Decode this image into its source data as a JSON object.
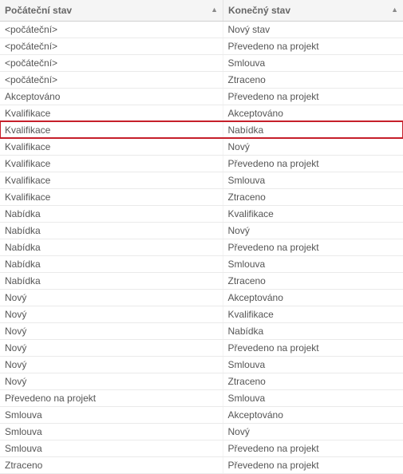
{
  "header": {
    "initial_state_label": "Počáteční stav",
    "final_state_label": "Konečný stav",
    "sort_icon": "▲"
  },
  "rows": [
    {
      "initial": "<počáteční>",
      "final": "Nový stav"
    },
    {
      "initial": "<počáteční>",
      "final": "Převedeno na projekt"
    },
    {
      "initial": "<počáteční>",
      "final": "Smlouva"
    },
    {
      "initial": "<počáteční>",
      "final": "Ztraceno"
    },
    {
      "initial": "Akceptováno",
      "final": "Převedeno na projekt"
    },
    {
      "initial": "Kvalifikace",
      "final": "Akceptováno"
    },
    {
      "initial": "Kvalifikace",
      "final": "Nabídka",
      "highlight": true
    },
    {
      "initial": "Kvalifikace",
      "final": "Nový"
    },
    {
      "initial": "Kvalifikace",
      "final": "Převedeno na projekt"
    },
    {
      "initial": "Kvalifikace",
      "final": "Smlouva"
    },
    {
      "initial": "Kvalifikace",
      "final": "Ztraceno"
    },
    {
      "initial": "Nabídka",
      "final": "Kvalifikace"
    },
    {
      "initial": "Nabídka",
      "final": "Nový"
    },
    {
      "initial": "Nabídka",
      "final": "Převedeno na projekt"
    },
    {
      "initial": "Nabídka",
      "final": "Smlouva"
    },
    {
      "initial": "Nabídka",
      "final": "Ztraceno"
    },
    {
      "initial": "Nový",
      "final": "Akceptováno"
    },
    {
      "initial": "Nový",
      "final": "Kvalifikace"
    },
    {
      "initial": "Nový",
      "final": "Nabídka"
    },
    {
      "initial": "Nový",
      "final": "Převedeno na projekt"
    },
    {
      "initial": "Nový",
      "final": "Smlouva"
    },
    {
      "initial": "Nový",
      "final": "Ztraceno"
    },
    {
      "initial": "Převedeno na projekt",
      "final": "Smlouva"
    },
    {
      "initial": "Smlouva",
      "final": "Akceptováno"
    },
    {
      "initial": "Smlouva",
      "final": "Nový"
    },
    {
      "initial": "Smlouva",
      "final": "Převedeno na projekt"
    },
    {
      "initial": "Ztraceno",
      "final": "Převedeno na projekt"
    }
  ],
  "highlight_box_color": "#c61f2a"
}
